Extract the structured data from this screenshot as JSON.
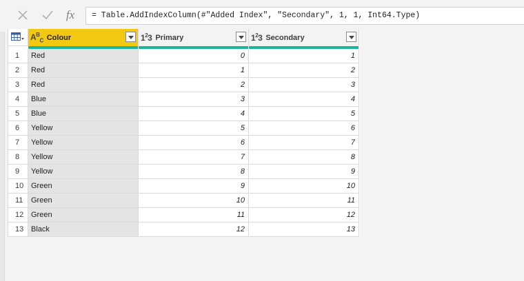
{
  "formula_bar": {
    "cancel_icon": "close-icon",
    "confirm_icon": "check-icon",
    "fx_label": "fx",
    "formula": "= Table.AddIndexColumn(#\"Added Index\", \"Secondary\", 1, 1, Int64.Type)"
  },
  "table": {
    "columns": [
      {
        "name": "Colour",
        "type_icon": "ABC",
        "selected": true
      },
      {
        "name": "Primary",
        "type_icon": "123",
        "selected": false
      },
      {
        "name": "Secondary",
        "type_icon": "123",
        "selected": false
      }
    ],
    "rows": [
      {
        "n": "1",
        "colour": "Red",
        "primary": "0",
        "secondary": "1"
      },
      {
        "n": "2",
        "colour": "Red",
        "primary": "1",
        "secondary": "2"
      },
      {
        "n": "3",
        "colour": "Red",
        "primary": "2",
        "secondary": "3"
      },
      {
        "n": "4",
        "colour": "Blue",
        "primary": "3",
        "secondary": "4"
      },
      {
        "n": "5",
        "colour": "Blue",
        "primary": "4",
        "secondary": "5"
      },
      {
        "n": "6",
        "colour": "Yellow",
        "primary": "5",
        "secondary": "6"
      },
      {
        "n": "7",
        "colour": "Yellow",
        "primary": "6",
        "secondary": "7"
      },
      {
        "n": "8",
        "colour": "Yellow",
        "primary": "7",
        "secondary": "8"
      },
      {
        "n": "9",
        "colour": "Yellow",
        "primary": "8",
        "secondary": "9"
      },
      {
        "n": "10",
        "colour": "Green",
        "primary": "9",
        "secondary": "10"
      },
      {
        "n": "11",
        "colour": "Green",
        "primary": "10",
        "secondary": "11"
      },
      {
        "n": "12",
        "colour": "Green",
        "primary": "11",
        "secondary": "12"
      },
      {
        "n": "13",
        "colour": "Black",
        "primary": "12",
        "secondary": "13"
      }
    ]
  },
  "colors": {
    "selected_header": "#f2c811",
    "quality_bar": "#18b69b",
    "selected_column_bg": "#e4e4e4"
  }
}
